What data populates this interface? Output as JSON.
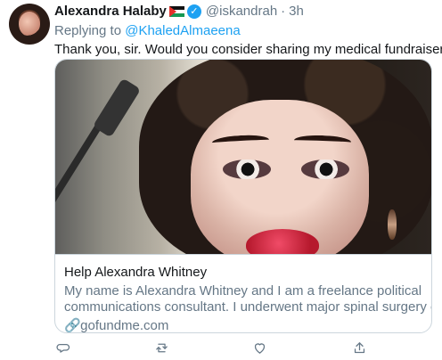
{
  "tweet": {
    "author_name": "Alexandra Halaby",
    "handle": "@iskandrah",
    "time": "3h",
    "replying_prefix": "Replying to",
    "replying_to": "@KhaledAlmaeena",
    "text": "Thank you, sir. Would you consider sharing my medical fundraiser:"
  },
  "card": {
    "title": "Help Alexandra Whitney",
    "description_line_1": "My name is Alexandra Whitney and I am a freelance political",
    "description_line_2": "communications consultant. I underwent major spinal surgery on ...",
    "domain": "gofundme.com"
  },
  "actions": {
    "reply_icon": "reply-icon",
    "retweet_icon": "retweet-icon",
    "like_icon": "heart-icon",
    "share_icon": "share-icon"
  },
  "colors": {
    "accent": "#1da1f2",
    "text": "#14171a",
    "muted": "#657786",
    "border": "#ccd6dd"
  }
}
